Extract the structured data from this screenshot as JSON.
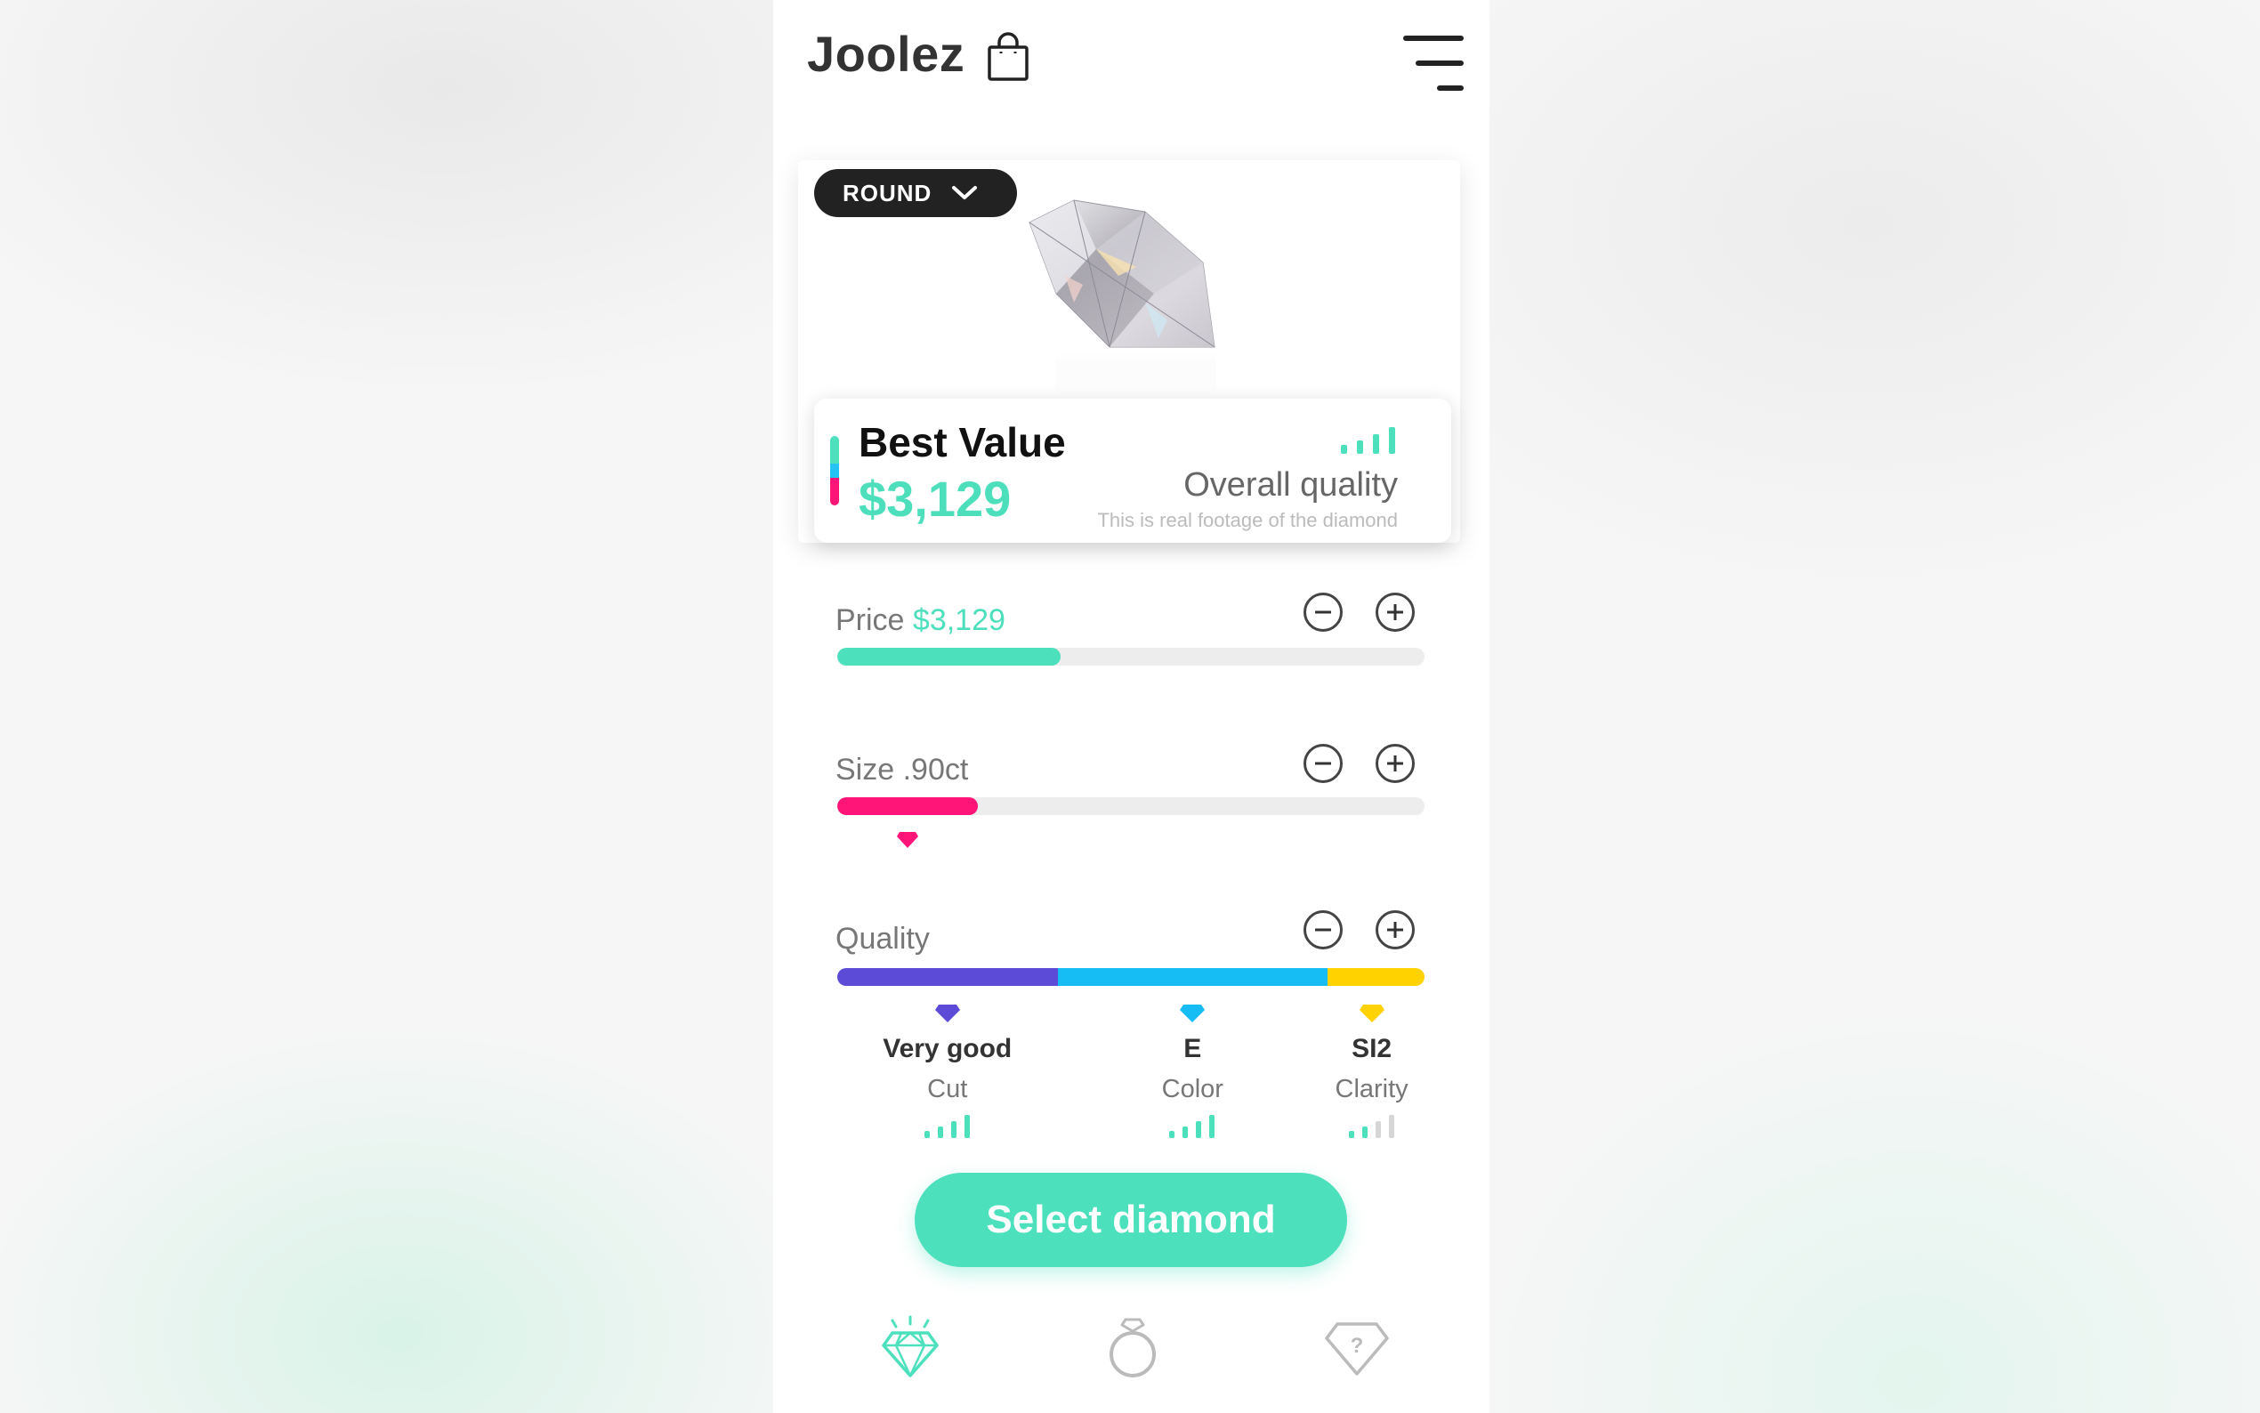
{
  "header": {
    "brand": "Joolez",
    "bag_icon": "shopping-bag-icon",
    "menu_icon": "hamburger-menu-icon"
  },
  "hero": {
    "shape_label": "ROUND",
    "diamond_image": "round-diamond-image"
  },
  "summary": {
    "title": "Best Value",
    "price": "$3,129",
    "overall_label": "Overall quality",
    "overall_level": 4,
    "footage_note": "This is real footage of the diamond"
  },
  "sliders": {
    "price": {
      "label": "Price",
      "value": "$3,129",
      "fill": 0.38,
      "color": "#4de0bd"
    },
    "size": {
      "label": "Size .90ct",
      "fill": 0.24,
      "color": "#ff1477"
    },
    "quality": {
      "label": "Quality",
      "segments": [
        {
          "name": "cut",
          "fraction": 0.375,
          "color": "#5b4bd6"
        },
        {
          "name": "color",
          "fraction": 0.46,
          "color": "#16bdf5"
        },
        {
          "name": "clarity",
          "fraction": 0.165,
          "color": "#ffd200"
        }
      ]
    }
  },
  "quality_items": [
    {
      "value": "Very good",
      "label": "Cut",
      "level": 4,
      "color": "#5b4bd6"
    },
    {
      "value": "E",
      "label": "Color",
      "level": 4,
      "color": "#16bdf5"
    },
    {
      "value": "SI2",
      "label": "Clarity",
      "level": 2,
      "color": "#ffd200"
    }
  ],
  "cta": {
    "label": "Select diamond"
  },
  "bottom_nav": [
    {
      "icon": "diamond-icon",
      "active": true
    },
    {
      "icon": "ring-icon",
      "active": false
    },
    {
      "icon": "diamond-question-icon",
      "active": false
    }
  ],
  "colors": {
    "accent": "#4de0bd",
    "size": "#ff1477",
    "text_dark": "#333333",
    "inactive_icon": "#bbbbbb"
  }
}
